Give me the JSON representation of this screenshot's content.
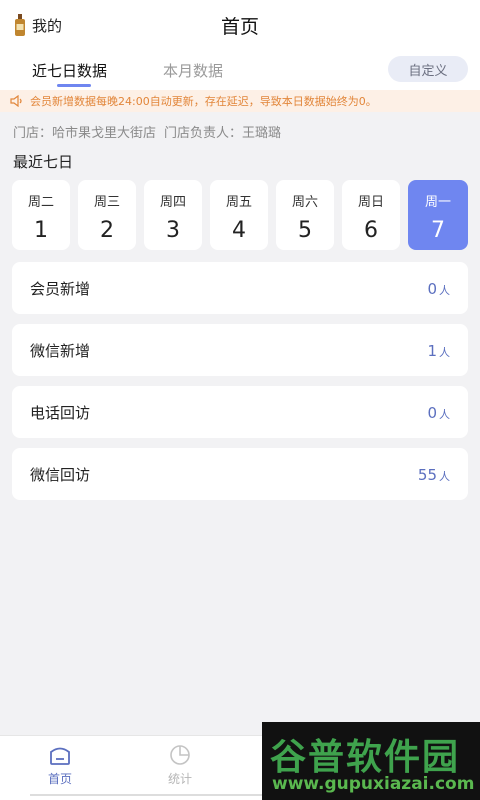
{
  "header": {
    "me_label": "我的",
    "title": "首页"
  },
  "tabs": {
    "active_label": "近七日数据",
    "inactive_label": "本月数据",
    "custom_label": "自定义"
  },
  "notice": {
    "text": "会员新增数据每晚24:00自动更新，存在延迟，导致本日数据始终为0。"
  },
  "store": {
    "store_text": "门店：哈市果戈里大街店",
    "manager_text": "门店负责人：王璐璐"
  },
  "section_title": "最近七日",
  "days": [
    {
      "weekday": "周二",
      "num": "1"
    },
    {
      "weekday": "周三",
      "num": "2"
    },
    {
      "weekday": "周四",
      "num": "3"
    },
    {
      "weekday": "周五",
      "num": "4"
    },
    {
      "weekday": "周六",
      "num": "5"
    },
    {
      "weekday": "周日",
      "num": "6"
    },
    {
      "weekday": "周一",
      "num": "7",
      "selected": true
    }
  ],
  "stats": [
    {
      "label": "会员新增",
      "value": "0",
      "unit": "人"
    },
    {
      "label": "微信新增",
      "value": "1",
      "unit": "人"
    },
    {
      "label": "电话回访",
      "value": "0",
      "unit": "人"
    },
    {
      "label": "微信回访",
      "value": "55",
      "unit": "人"
    }
  ],
  "bottom_nav": {
    "home_label": "首页",
    "stats_label": "统计"
  },
  "watermark": {
    "title": "谷普软件园",
    "url": "www.gupuxiazai.com"
  },
  "colors": {
    "accent": "#6f86f0",
    "value_text": "#5b6fbf",
    "notice_text": "#e2863a",
    "notice_bg": "#fdf0e6"
  },
  "icons": {
    "me": "bottle-icon",
    "notice": "speaker-icon",
    "home": "home-icon",
    "stats": "pie-chart-icon"
  }
}
